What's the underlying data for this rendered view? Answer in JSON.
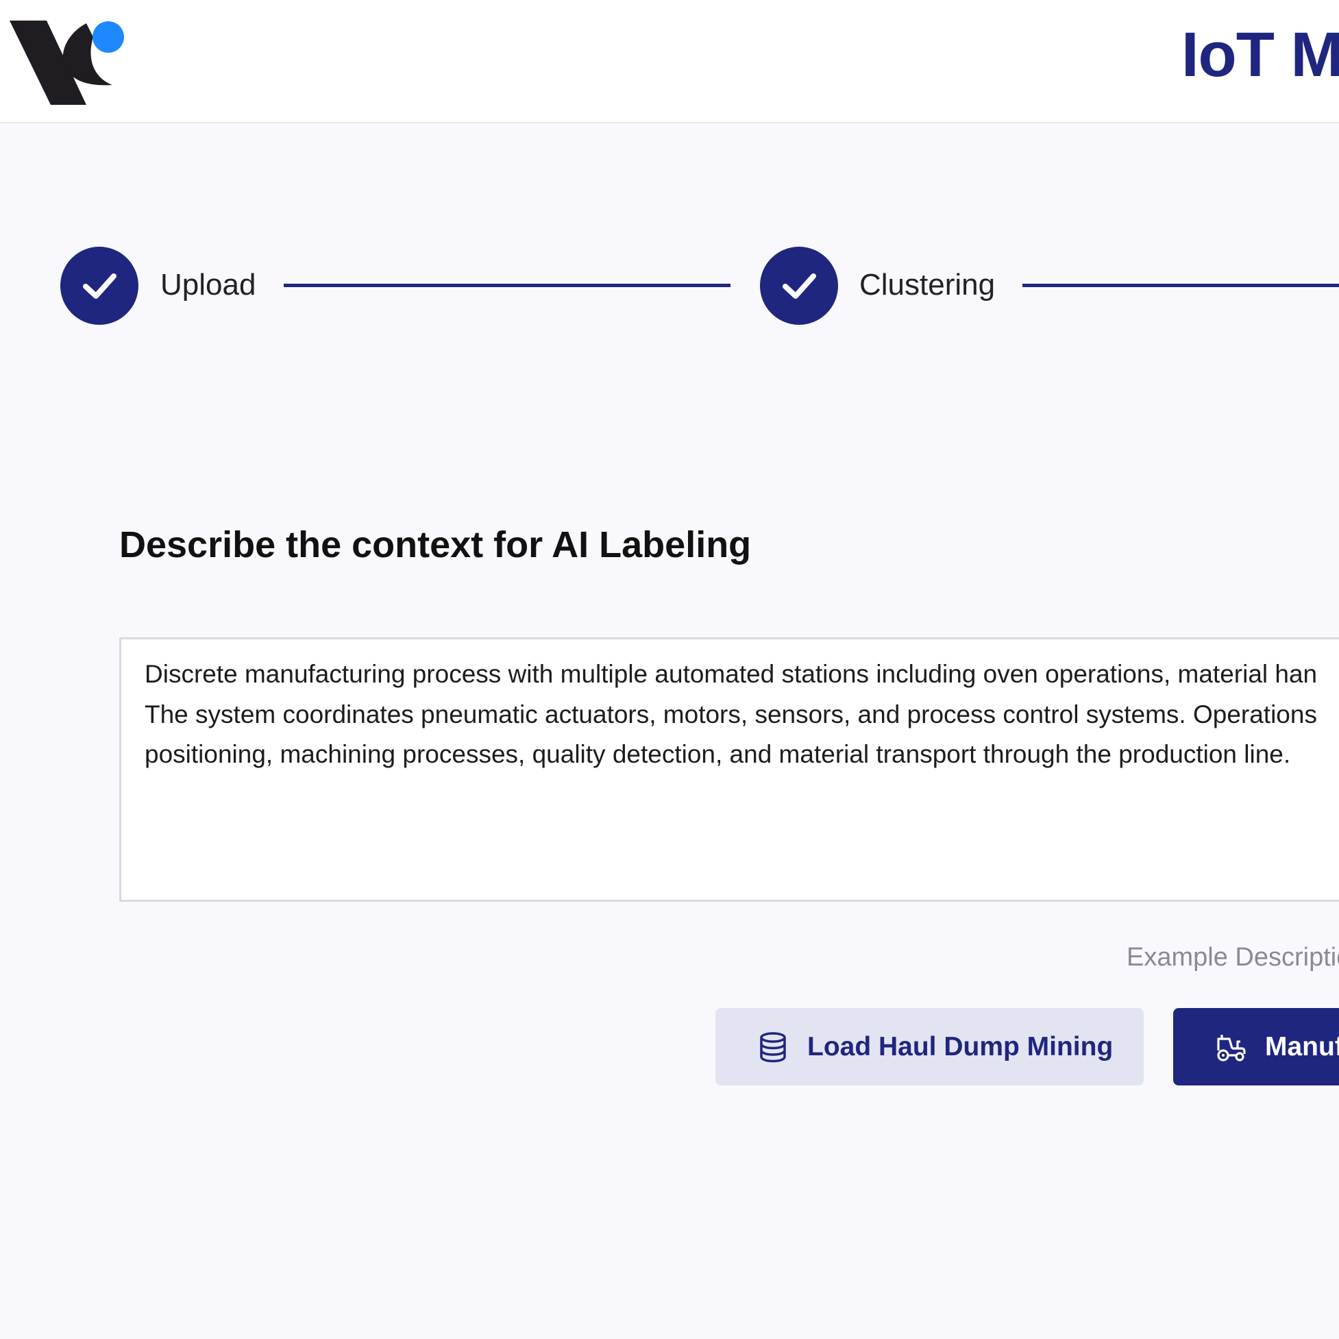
{
  "header": {
    "app_title": "IoT M"
  },
  "stepper": {
    "steps": [
      {
        "label": "Upload",
        "status": "complete",
        "icon": "check-icon"
      },
      {
        "label": "Clustering",
        "status": "complete",
        "icon": "check-icon"
      }
    ]
  },
  "main": {
    "heading": "Describe the context for AI Labeling",
    "context": {
      "lines": [
        "Discrete manufacturing process with multiple automated stations including oven operations, material han",
        "The system coordinates pneumatic actuators, motors, sensors, and process control systems. Operations",
        "positioning, machining processes, quality detection, and material transport through the production line."
      ]
    },
    "examples": {
      "label": "Example Descriptio",
      "buttons": [
        {
          "label": "Load Haul Dump Mining",
          "icon": "database-icon"
        },
        {
          "label": "Manuf",
          "icon": "tractor-icon"
        }
      ]
    }
  },
  "colors": {
    "primary": "#1f267f",
    "secondary_bg": "#e3e4f2",
    "logo_dot": "#1e88ff",
    "page_bg": "#f9f9fd"
  }
}
